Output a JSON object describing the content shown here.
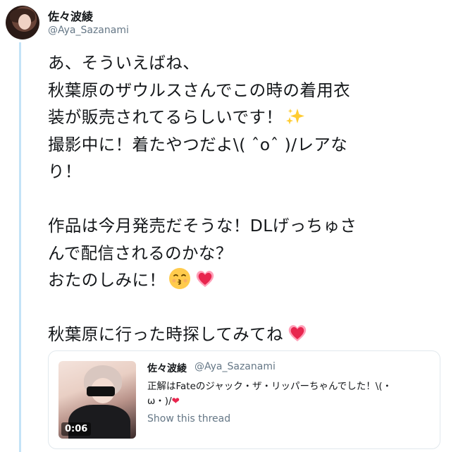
{
  "tweet": {
    "author": {
      "name": "佐々波綾",
      "handle": "@Aya_Sazanami"
    },
    "text_lines": [
      "あ、そういえばね、",
      "秋葉原のザウルスさんでこの時の着用衣",
      "装が販売されてるらしいです！",
      "撮影中に！着たやつだよ\\( ˆoˆ )/レアな",
      "り！",
      "",
      "作品は今月発売だそうな！DLげっちゅさ",
      "んで配信されるのかな？",
      "おたのしみに！",
      "",
      "秋葉原に行った時探してみてね"
    ],
    "emojis": {
      "sparkles": "sparkles-icon",
      "kissing": "kissing-face-icon",
      "heart": "heart-icon"
    }
  },
  "quoted": {
    "author": {
      "name": "佐々波綾",
      "handle": "@Aya_Sazanami"
    },
    "text_line1": "正解はFateのジャック・ザ・リッパーちゃんでした！\\(・",
    "text_line2": "ω・)/",
    "video_duration": "0:06",
    "show_thread": "Show this thread"
  }
}
